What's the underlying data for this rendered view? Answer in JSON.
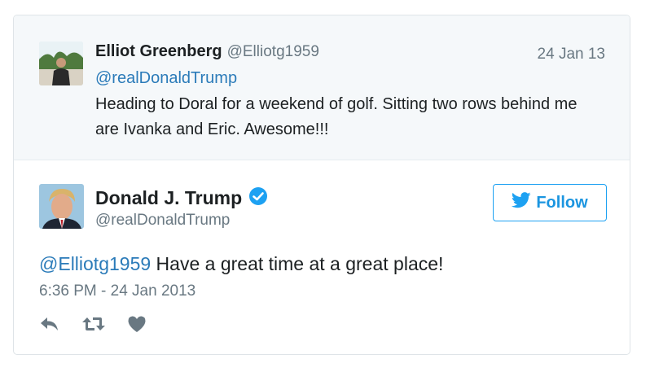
{
  "quoted_tweet": {
    "name": "Elliot Greenberg",
    "handle": "@Elliotg1959",
    "date": "24 Jan 13",
    "mention": "@realDonaldTrump",
    "text": "Heading to Doral for a weekend of golf. Sitting two rows behind me are Ivanka and Eric. Awesome!!!"
  },
  "tweet": {
    "name": "Donald J. Trump",
    "handle": "@realDonaldTrump",
    "verified": true,
    "mention": "@Elliotg1959",
    "text": " Have a great time at a great place!",
    "timestamp": "6:36 PM - 24 Jan 2013"
  },
  "follow_button": {
    "label": "Follow",
    "icon": "twitter-bird-icon"
  },
  "actions": [
    {
      "icon": "reply-icon"
    },
    {
      "icon": "retweet-icon"
    },
    {
      "icon": "heart-icon"
    }
  ],
  "colors": {
    "link": "#2b7bb9",
    "accent": "#1da1f2",
    "muted": "#697882",
    "quoted_bg": "#f5f8fa"
  }
}
